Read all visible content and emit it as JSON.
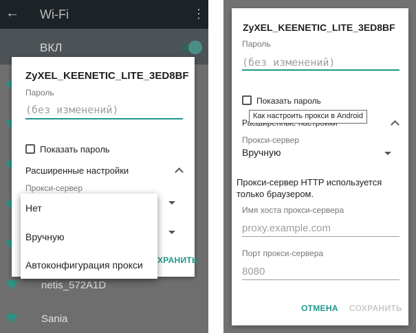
{
  "left": {
    "appbar": {
      "back_icon": "arrow-back-icon",
      "title": "Wi-Fi",
      "more_icon": "more-vert-icon"
    },
    "switch_label": "ВКЛ",
    "networks": [
      "netis_572A1D",
      "Sania"
    ],
    "dialog": {
      "title": "ZyXEL_KEENETIC_LITE_3ED8BF",
      "password_label": "Пароль",
      "password_placeholder": "(без изменений)",
      "show_password": "Показать пароль",
      "advanced": "Расширенные настройки",
      "proxy_label": "Прокси-сервер",
      "save_partial": "ХРАНИТЬ"
    },
    "menu": [
      "Нет",
      "Вручную",
      "Автоконфигурация прокси"
    ]
  },
  "right": {
    "dialog": {
      "title": "ZyXEL_KEENETIC_LITE_3ED8BF",
      "password_label": "Пароль",
      "password_placeholder": "(без изменений)",
      "show_password": "Показать пароль",
      "advanced": "Расширенные настройки",
      "proxy_label": "Прокси-сервер",
      "proxy_value": "Вручную",
      "proxy_note_1": "Прокси-сервер HTTP используется",
      "proxy_note_2": "только браузером.",
      "host_label": "Имя хоста прокси-сервера",
      "host_placeholder": "proxy.example.com",
      "port_label": "Порт прокси-сервера",
      "port_value": "8080",
      "cancel": "ОТМЕНА",
      "save": "СОХРАНИТЬ"
    },
    "tooltip": "Как настроить прокси в Android"
  },
  "colors": {
    "accent": "#1e968a",
    "appbar": "#1c2226",
    "dim": "#6e6e6e"
  }
}
